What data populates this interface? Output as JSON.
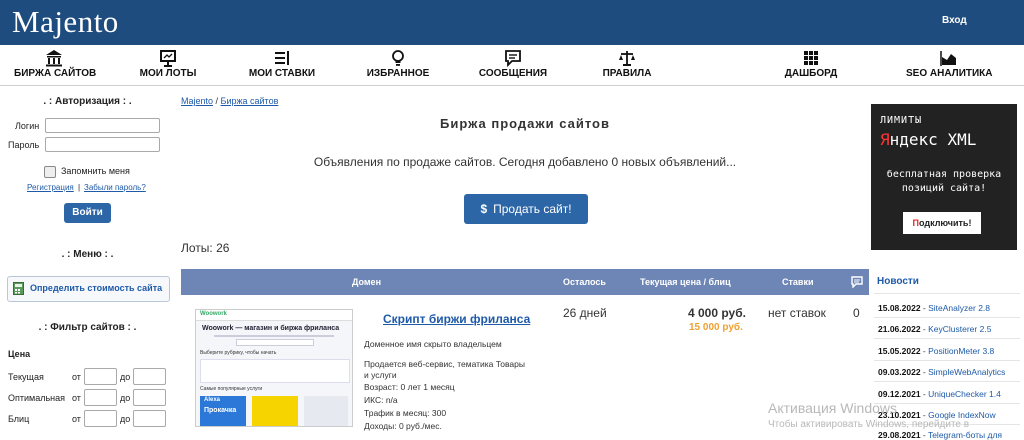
{
  "header": {
    "logo": "Majento",
    "login": "Вход"
  },
  "nav": [
    {
      "label": "БИРЖА САЙТОВ",
      "icon": "bank-icon"
    },
    {
      "label": "МОИ ЛОТЫ",
      "icon": "presentation-icon"
    },
    {
      "label": "МОИ СТАВКИ",
      "icon": "list-icon"
    },
    {
      "label": "ИЗБРАННОЕ",
      "icon": "lightbulb-icon"
    },
    {
      "label": "СООБЩЕНИЯ",
      "icon": "chat-icon"
    },
    {
      "label": "ПРАВИЛА",
      "icon": "scales-icon"
    },
    {
      "label": "ДАШБОРД",
      "icon": "grid-icon"
    },
    {
      "label": "SEO АНАЛИТИКА",
      "icon": "area-chart-icon"
    }
  ],
  "auth": {
    "title": ". : Авторизация : .",
    "login_label": "Логин",
    "password_label": "Пароль",
    "remember": "Запомнить меня",
    "register": "Регистрация",
    "sep": " | ",
    "forgot": "Забыли пароль?",
    "submit": "Войти"
  },
  "menu": {
    "title": ". : Меню : .",
    "estimate": "Определить стоимость сайта"
  },
  "filter": {
    "title": ". : Фильтр сайтов : .",
    "price_label": "Цена",
    "rows": [
      {
        "label": "Текущая",
        "from": "от",
        "to": "до"
      },
      {
        "label": "Оптимальная",
        "from": "от",
        "to": "до"
      },
      {
        "label": "Блиц",
        "from": "от",
        "to": "до"
      }
    ]
  },
  "breadcrumb": {
    "home": "Majento",
    "sep": " / ",
    "current": "Биржа сайтов"
  },
  "main": {
    "title": "Биржа продажи сайтов",
    "description": "Объявления по продаже сайтов. Сегодня добавлено 0 новых объявлений...",
    "sell_button": "Продать сайт!",
    "lots": "Лоты: 26"
  },
  "table": {
    "headers": {
      "domain": "Домен",
      "remaining": "Осталось",
      "price": "Текущая цена / блиц",
      "bids": "Ставки"
    },
    "row": {
      "title": "Скрипт биржи фриланса",
      "hidden": "Доменное имя скрыто владельцем",
      "details": [
        "Продается веб-сервис, тематика Товары",
        "и услуги",
        "Возраст: 0 лет 1 месяц",
        "ИКС: n/a",
        "Трафик в месяц: 300",
        "Доходы: 0 руб./мес."
      ],
      "remaining": "26 дней",
      "price": "4 000 руб.",
      "blitz": "15 000 руб.",
      "bids": "нет ставок",
      "comments": "0",
      "thumb": {
        "brand": "Woowork",
        "headline": "Woowork — магазин и биржа фриланса",
        "section1": "Выберите рубрику, чтобы начать",
        "section2": "Самые популярные услуги",
        "badge": "Alexa",
        "badge2": "Прокачка"
      }
    }
  },
  "ad": {
    "line1": "ЛИМИТЫ",
    "line2_red": "Я",
    "line2_rest": "ндекс XML",
    "line3": "бесплатная проверка",
    "line4": "позиций сайта!",
    "button_red": "П",
    "button_rest": "одключить!"
  },
  "news": {
    "title": "Новости",
    "items": [
      {
        "date": "15.08.2022",
        "text": "SiteAnalyzer 2.8"
      },
      {
        "date": "21.06.2022",
        "text": "KeyClusterer 2.5"
      },
      {
        "date": "15.05.2022",
        "text": "PositionMeter 3.8"
      },
      {
        "date": "09.03.2022",
        "text": "SimpleWebAnalytics"
      },
      {
        "date": "09.12.2021",
        "text": "UniqueChecker 1.4"
      },
      {
        "date": "23.10.2021",
        "text": "Google IndexNow"
      },
      {
        "date": "29.08.2021",
        "text": "Telegram-боты для"
      }
    ]
  },
  "watermark": {
    "line1": "Активация Windows",
    "line2": "Чтобы активировать Windows, перейдите в"
  },
  "colors": {
    "header": "#1f4c7e",
    "accent": "#2c66a6",
    "table_head": "#6d86b6",
    "blitz": "#f0a030"
  }
}
